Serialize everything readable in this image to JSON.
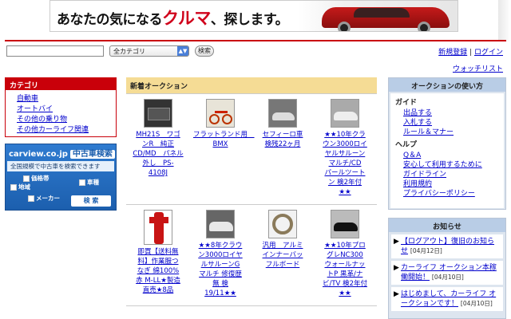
{
  "banner": {
    "pre": "あなたの気になる",
    "accent": "クルマ",
    "post": "、探します。"
  },
  "search": {
    "query": "",
    "category": "全カテゴリ",
    "button": "検索"
  },
  "account": {
    "register": "新規登録",
    "sep": "|",
    "login": "ログイン",
    "watchlist": "ウォッチリスト"
  },
  "sidebar": {
    "title": "カテゴリ",
    "items": [
      "自動車",
      "オートバイ",
      "その他の乗り物",
      "その他カーライフ関連"
    ]
  },
  "carview": {
    "logo": "carview.co.jp",
    "sub": "中古車検索",
    "desc": "全国規模で中古車を検索できます",
    "checks": [
      "価格帯",
      "車種",
      "地域",
      "メーカー"
    ],
    "button": "検 索"
  },
  "main": {
    "title": "新着オークション",
    "row1": [
      {
        "icon": "audio-unit-photo",
        "lines": [
          "MH21S　ワゴ",
          "ンR　純正",
          "CD/MD　パネル",
          "外し　PS-",
          "4108J"
        ]
      },
      {
        "icon": "bicycle-photo",
        "lines": [
          "フラットランド用　BMX"
        ]
      },
      {
        "icon": "car-photo",
        "lines": [
          "セフィーロ車",
          "検残22ヶ月"
        ]
      },
      {
        "icon": "sedan-photo",
        "lines": [
          "★★10年クラ",
          "ウン3000ロイ",
          "ヤルサルーン",
          "マルチ/CD",
          "パールツート",
          "ン 検2年付",
          "★★"
        ]
      }
    ],
    "row2": [
      {
        "icon": "work-clothes-photo",
        "lines": [
          "即買【送料無",
          "料】作業服つ",
          "なぎ 綿100%",
          "赤 M-LL★製造",
          "直売★8品"
        ]
      },
      {
        "icon": "sedan-photo",
        "lines": [
          "★★8年クラウ",
          "ン3000ロイヤ",
          "ルサルーンG",
          "マルチ 修復歴",
          "無 検",
          "19/11★★"
        ]
      },
      {
        "icon": "steering-ring-photo",
        "lines": [
          "汎用　アルミ",
          "インナーバッ",
          "フルボード"
        ]
      },
      {
        "icon": "sedan-photo",
        "lines": [
          "★★10年プロ",
          "グレNC300",
          "ウォールナッ",
          "トP 黒革/ナ",
          "ビ/TV 検2年付",
          "★★"
        ]
      }
    ]
  },
  "help": {
    "title": "オークションの使い方",
    "guide_title": "ガイド",
    "guide": [
      "出品する",
      "入札する",
      "ルール＆マナー"
    ],
    "help_title": "ヘルプ",
    "help": [
      "Q＆A",
      "安心して利用するために",
      "ガイドライン",
      "利用規約",
      "プライバシーポリシー"
    ]
  },
  "news": {
    "title": "お知らせ",
    "items": [
      {
        "text": "【ログアウト】復旧のお知らせ",
        "date": "[04月12日]"
      },
      {
        "text": "カーライフ オークション本稼働開始！",
        "date": "[04月10日]"
      },
      {
        "text": "はじめまして、カーライフ オークションです！",
        "date": "[04月10日]"
      }
    ]
  },
  "colors": {
    "accent_red": "#c9000a",
    "link": "#0000cc",
    "header_yellow": "#f5dc95",
    "panel_blue": "#dde5ef"
  }
}
